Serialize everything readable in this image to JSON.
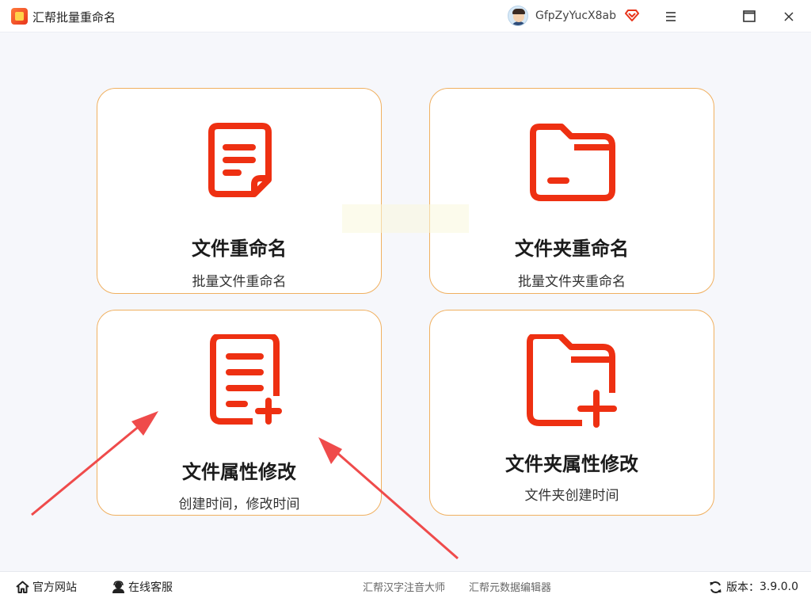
{
  "window": {
    "title": "汇帮批量重命名",
    "username": "GfpZyYucX8ab"
  },
  "cards": [
    {
      "title": "文件重命名",
      "subtitle": "批量文件重命名",
      "icon": "document-icon"
    },
    {
      "title": "文件夹重命名",
      "subtitle": "批量文件夹重命名",
      "icon": "folder-icon"
    },
    {
      "title": "文件属性修改",
      "subtitle": "创建时间，修改时间",
      "icon": "document-add-icon"
    },
    {
      "title": "文件夹属性修改",
      "subtitle": "文件夹创建时间",
      "icon": "folder-add-icon"
    }
  ],
  "footer": {
    "official_site": "官方网站",
    "online_service": "在线客服",
    "link1": "汇帮汉字注音大师",
    "link2": "汇帮元数据编辑器",
    "version_label": "版本：",
    "version": "3.9.0.0"
  },
  "colors": {
    "accent": "#ee3012",
    "card_border": "#f0b060",
    "arrow": "#ef4b4b"
  }
}
